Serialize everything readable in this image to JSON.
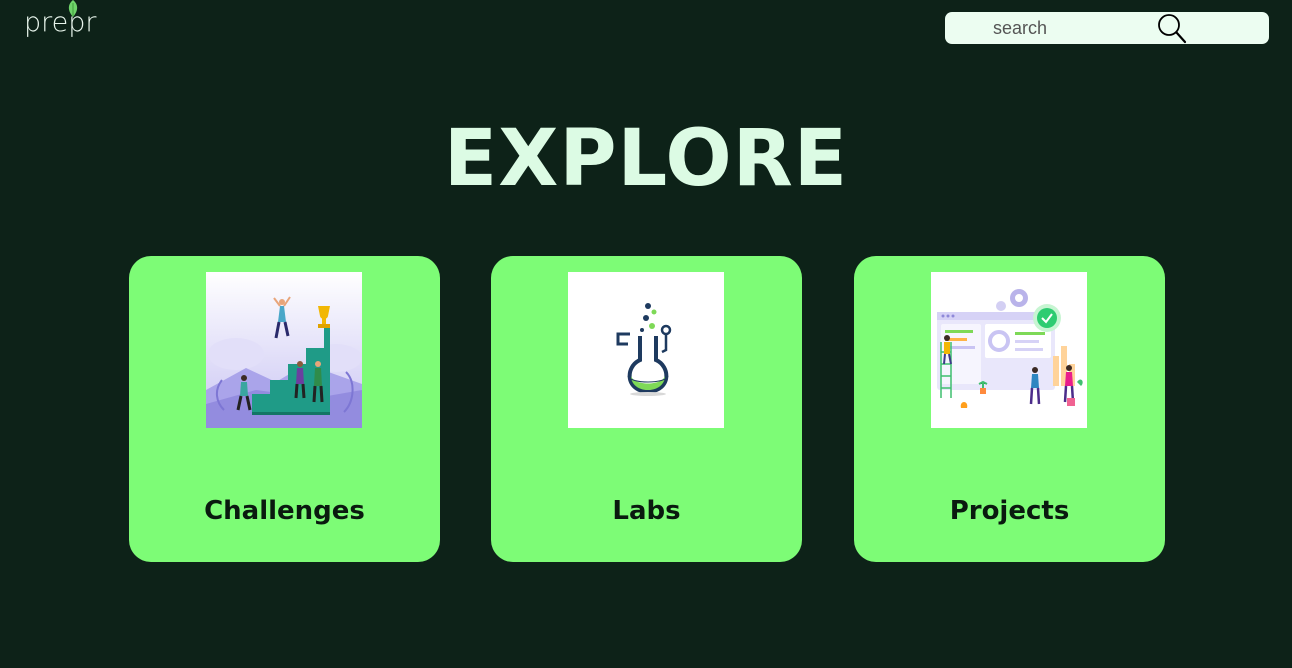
{
  "header": {
    "logo_text": "prepr",
    "search": {
      "placeholder": "search",
      "value": ""
    }
  },
  "main": {
    "title": "EXPLORE",
    "cards": [
      {
        "label": "Challenges",
        "image": "team-climbing-stairs-trophy-illustration"
      },
      {
        "label": "Labs",
        "image": "lab-flask-illustration"
      },
      {
        "label": "Projects",
        "image": "team-building-dashboard-illustration"
      }
    ]
  },
  "colors": {
    "background": "#0d2218",
    "card": "#7dfc76",
    "title": "#dcfbe4",
    "search_bg": "#ecfdf1",
    "leaf": "#6fd36a"
  }
}
